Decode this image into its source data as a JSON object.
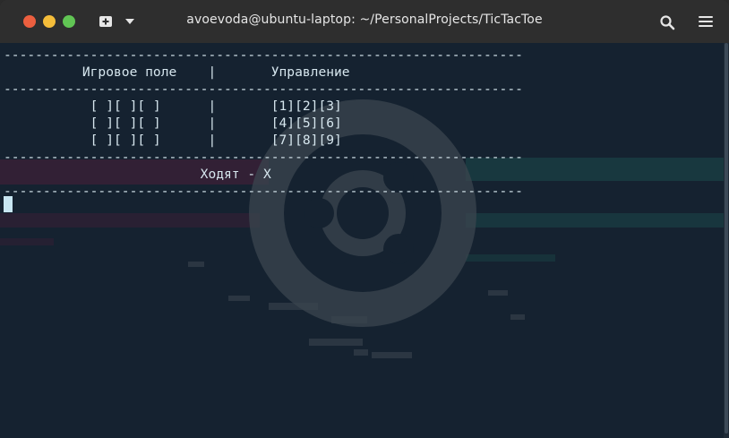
{
  "window": {
    "title": "avoevoda@ubuntu-laptop: ~/PersonalProjects/TicTacToe"
  },
  "terminal": {
    "lines": [
      "------------------------------------------------------------------",
      "          Игровое поле    |       Управление",
      "------------------------------------------------------------------",
      "           [ ][ ][ ]      |       [1][2][3]",
      "           [ ][ ][ ]      |       [4][5][6]",
      "           [ ][ ][ ]      |       [7][8][9]",
      "------------------------------------------------------------------",
      "                         Ходят - X",
      "------------------------------------------------------------------"
    ]
  },
  "icons": {
    "close": "close-dot",
    "minimize": "minimize-dot",
    "maximize": "maximize-dot",
    "new_tab": "new-tab-icon",
    "tab_menu": "chevron-down-icon",
    "search": "search-icon",
    "menu": "hamburger-menu-icon"
  },
  "colors": {
    "terminal_bg": "#152230",
    "terminal_text": "#d6e6ee",
    "titlebar": "#2e2e2e",
    "close": "#ec5f3f",
    "minimize": "#f5bd3a",
    "maximize": "#61c554"
  }
}
